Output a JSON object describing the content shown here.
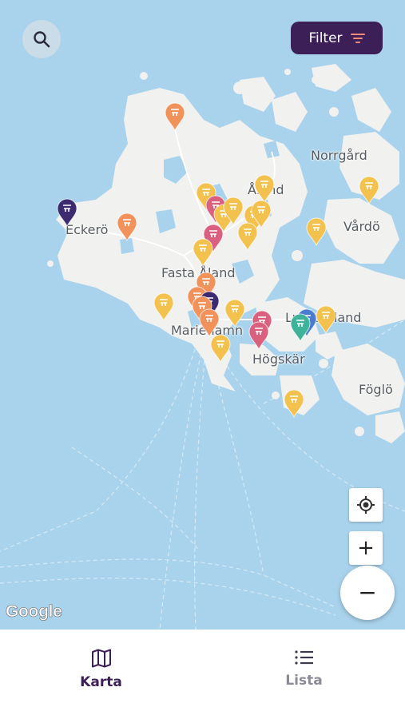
{
  "map": {
    "attribution": "Google",
    "places": [
      {
        "name": "Norrgård"
      },
      {
        "name": "Åland"
      },
      {
        "name": "Vårdö"
      },
      {
        "name": "Eckerö"
      },
      {
        "name": "Fasta Åland"
      },
      {
        "name": "Mariehamn"
      },
      {
        "name": "Lumparland"
      },
      {
        "name": "Högskär"
      },
      {
        "name": "Föglö"
      }
    ],
    "marker_colors": {
      "yellow": "#f2c14e",
      "orange": "#f0925a",
      "pink": "#d9607e",
      "green": "#3fb39a",
      "blue": "#4a7bd0",
      "navy": "#3c2b6e"
    }
  },
  "header": {
    "search_icon": "search-icon",
    "filter_label": "Filter",
    "filter_icon": "filter-lines-icon"
  },
  "controls": {
    "locate_icon": "crosshair-icon",
    "zoom_in": "+",
    "zoom_out": "−"
  },
  "tabs": [
    {
      "label": "Karta",
      "icon": "map-icon",
      "active": true
    },
    {
      "label": "Lista",
      "icon": "list-icon",
      "active": false
    }
  ],
  "colors": {
    "brand": "#3c1f56",
    "water": "#a9d3ec",
    "land": "#f1f1ef",
    "filter_accent": "#f08a7a"
  }
}
